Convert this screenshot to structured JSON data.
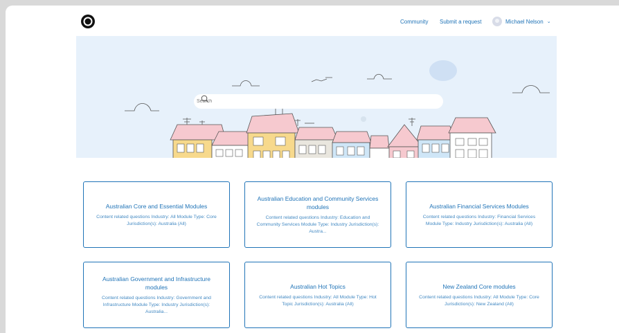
{
  "header": {
    "nav": [
      {
        "label": "Community"
      },
      {
        "label": "Submit a request"
      }
    ],
    "user_name": "Michael Nelson"
  },
  "search": {
    "placeholder": "Search"
  },
  "categories": [
    {
      "title": "Australian Core and Essential Modules",
      "description": "Content related questions Industry: All Module Type: Core Jurisdiction(s): Australia (All)"
    },
    {
      "title": "Australian Education and Community Services modules",
      "description": "Content related questions Industry: Education and Community Services Module Type: Industry Jurisdiction(s): Austra..."
    },
    {
      "title": "Australian Financial Services Modules",
      "description": "Content related questions Industry: Financial Services Module Type: Industry Jurisdiction(s): Australia (All)"
    },
    {
      "title": "Australian Government and Infrastructure modules",
      "description": "Content related questions Industry: Government and Infrastructure Module Type: Industry Jurisdiction(s): Australia..."
    },
    {
      "title": "Australian Hot Topics",
      "description": "Content related questions Industry: All Module Type: Hot Topic Jurisdiction(s): Australia (All)"
    },
    {
      "title": "New Zealand Core modules",
      "description": "Content related questions Industry: All Module Type: Core Jurisdiction(s): New Zealand (All)"
    }
  ],
  "colors": {
    "accent": "#1f73b7",
    "hero_bg": "#e7f1fb"
  }
}
